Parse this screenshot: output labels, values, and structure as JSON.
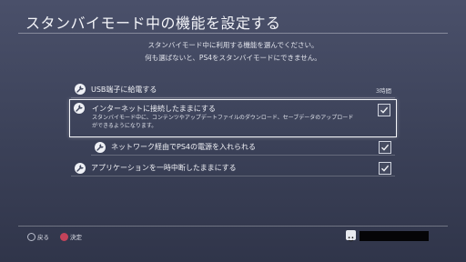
{
  "header": {
    "title": "スタンバイモード中の機能を設定する"
  },
  "description": {
    "line1": "スタンバイモード中に利用する機能を選んでください。",
    "line2": "何も選ばないと、PS4をスタンバイモードにできません。"
  },
  "settings": {
    "usb": {
      "label": "USB端子に給電する",
      "value": "3時間",
      "icon": "wrench-icon"
    },
    "internet": {
      "label": "インターネットに接続したままにする",
      "sub1": "スタンバイモード中に、コンテンツやアップデートファイルのダウンロード、セーブデータのアップロード",
      "sub2": "ができるようになります。",
      "checked": true,
      "icon": "wrench-icon"
    },
    "network_power": {
      "label": "ネットワーク経由でPS4の電源を入れられる",
      "checked": true,
      "icon": "wrench-icon"
    },
    "app_suspend": {
      "label": "アプリケーションを一時中断したままにする",
      "checked": true,
      "icon": "wrench-icon"
    }
  },
  "footer": {
    "back_label": "戻る",
    "ok_label": "決定"
  },
  "colors": {
    "accent_circle": "#c4435a",
    "background": "#3b4158"
  }
}
